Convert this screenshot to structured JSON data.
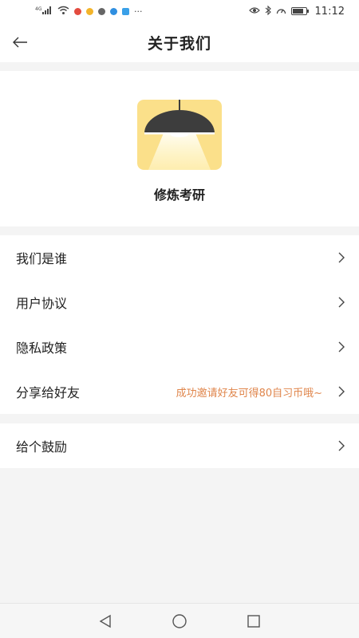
{
  "status_bar": {
    "network": "4G",
    "time": "11:12",
    "icons": [
      "signal-icon",
      "wifi-icon",
      "app-notification-icons",
      "more-icon",
      "eye-icon",
      "bluetooth-icon",
      "speedometer-icon",
      "battery-icon"
    ]
  },
  "header": {
    "back_icon": "arrow-left-icon",
    "title": "关于我们"
  },
  "app": {
    "name": "修炼考研",
    "logo": "lamp-logo",
    "logo_bg": "#fbe08a"
  },
  "menu": {
    "group1": [
      {
        "label": "我们是谁",
        "hint": ""
      },
      {
        "label": "用户协议",
        "hint": ""
      },
      {
        "label": "隐私政策",
        "hint": ""
      },
      {
        "label": "分享给好友",
        "hint": "成功邀请好友可得80自习币哦~"
      }
    ],
    "group2": [
      {
        "label": "给个鼓励",
        "hint": ""
      }
    ]
  },
  "nav": {
    "buttons": [
      "back-triangle-icon",
      "home-circle-icon",
      "recents-square-icon"
    ]
  },
  "colors": {
    "accent_hint": "#e0864c",
    "background": "#f4f4f4"
  }
}
